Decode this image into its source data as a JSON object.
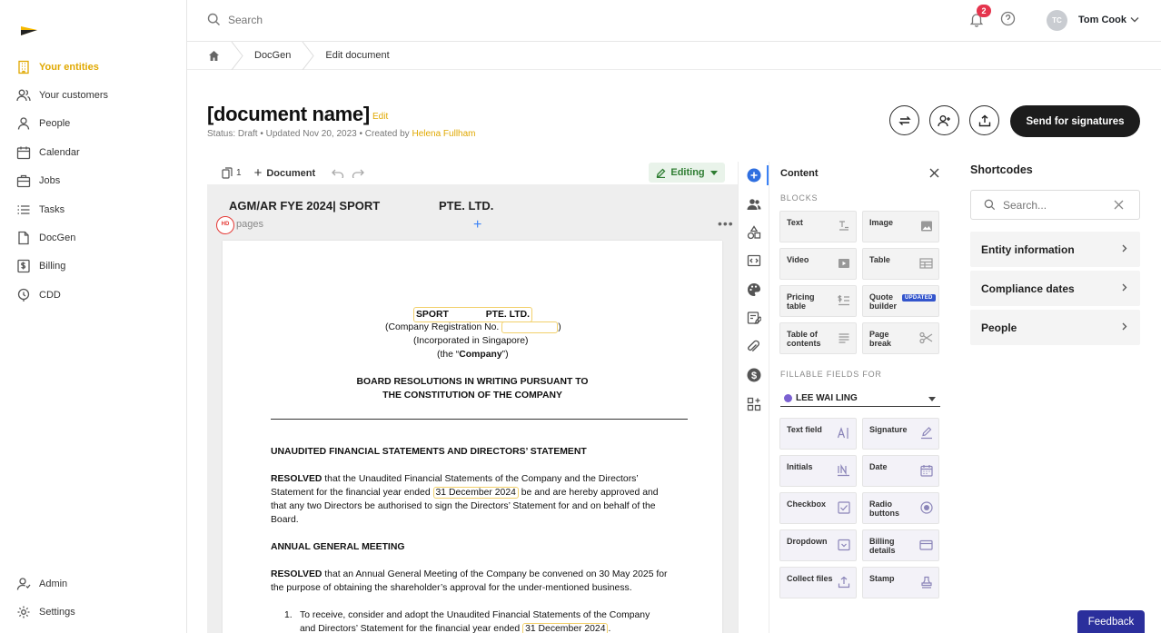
{
  "colors": {
    "accent": "#e0a800",
    "primary_dark": "#1c1c1c",
    "feedback": "#2b2f9c",
    "badge": "#e5344d"
  },
  "sidebar": {
    "items": [
      {
        "label": "Your entities",
        "icon": "building-icon"
      },
      {
        "label": "Your customers",
        "icon": "users-icon"
      },
      {
        "label": "People",
        "icon": "person-icon"
      },
      {
        "label": "Calendar",
        "icon": "calendar-icon"
      },
      {
        "label": "Jobs",
        "icon": "briefcase-icon"
      },
      {
        "label": "Tasks",
        "icon": "list-icon"
      },
      {
        "label": "DocGen",
        "icon": "document-icon"
      },
      {
        "label": "Billing",
        "icon": "billing-icon"
      },
      {
        "label": "CDD",
        "icon": "cdd-icon"
      }
    ],
    "bottom": [
      {
        "label": "Admin",
        "icon": "admin-icon"
      },
      {
        "label": "Settings",
        "icon": "gear-icon"
      }
    ]
  },
  "topbar": {
    "search_placeholder": "Search",
    "notification_count": "2",
    "user_initials": "TC",
    "user_name": "Tom Cook"
  },
  "breadcrumb": {
    "items": [
      "DocGen",
      "Edit document"
    ]
  },
  "document": {
    "title": "[document name]",
    "edit_label": "Edit",
    "status_text": "Status: Draft • Updated Nov 20, 2023 • Created by",
    "created_by": "Helena Fullham"
  },
  "actions": {
    "send_label": "Send for signatures"
  },
  "editor": {
    "page_count": "1",
    "add_document_label": "Document",
    "mode_label": "Editing",
    "header_left": "AGM/AR FYE 2024| SPORT",
    "header_right": "PTE. LTD.",
    "hd_badge": "HD",
    "pages_label": "pages"
  },
  "page": {
    "company_a": "SPORT",
    "company_b": "PTE. LTD.",
    "reg_label": "(Company Registration No.",
    "reg_close": ")",
    "incorporated": "(Incorporated in Singapore)",
    "the_company_pre": "(the “",
    "the_company_bold": "Company",
    "the_company_post": "”)",
    "heading1": "BOARD RESOLUTIONS IN WRITING PURSUANT TO",
    "heading2": "THE CONSTITUTION OF THE COMPANY",
    "section1": "UNAUDITED FINANCIAL STATEMENTS AND DIRECTORS’ STATEMENT",
    "resolved": "RESOLVED",
    "p1_a": "that the Unaudited Financial Statements of the Company and the Directors’",
    "p1_b": "Statement for the financial year ended",
    "p1_date": "31 December 2024",
    "p1_c": "be and are hereby approved and",
    "p1_d": "that any two Directors be authorised to sign the Directors’ Statement for and on behalf of the",
    "p1_e": "Board.",
    "section2": "ANNUAL GENERAL MEETING",
    "p2_a": "that an Annual General Meeting of the Company be convened on 30 May 2025 for",
    "p2_b": "the purpose of obtaining the shareholder’s approval for the under-mentioned business.",
    "li_num": "1.",
    "li_a": "To receive, consider and adopt the Unaudited Financial Statements of the Company",
    "li_b": "and Directors’ Statement for the financial year ended",
    "li_date": "31 December 2024",
    "li_end": "."
  },
  "content_panel": {
    "title": "Content",
    "blocks_heading": "BLOCKS",
    "blocks": [
      {
        "label": "Text",
        "icon": "text-format-icon"
      },
      {
        "label": "Image",
        "icon": "image-icon"
      },
      {
        "label": "Video",
        "icon": "video-icon"
      },
      {
        "label": "Table",
        "icon": "table-icon"
      },
      {
        "label": "Pricing table",
        "icon": "pricing-icon"
      },
      {
        "label": "Quote builder",
        "icon": "quote-icon",
        "badge": "UPDATED"
      },
      {
        "label": "Table of contents",
        "icon": "toc-icon"
      },
      {
        "label": "Page break",
        "icon": "scissors-icon"
      }
    ],
    "fillable_heading": "FILLABLE FIELDS FOR",
    "signer": "LEE WAI LING",
    "fields": [
      {
        "label": "Text field",
        "icon": "text-field-icon"
      },
      {
        "label": "Signature",
        "icon": "pen-icon"
      },
      {
        "label": "Initials",
        "icon": "initials-icon"
      },
      {
        "label": "Date",
        "icon": "calendar-icon"
      },
      {
        "label": "Checkbox",
        "icon": "checkbox-icon"
      },
      {
        "label": "Radio buttons",
        "icon": "radio-icon"
      },
      {
        "label": "Dropdown",
        "icon": "dropdown-icon"
      },
      {
        "label": "Billing details",
        "icon": "card-icon"
      },
      {
        "label": "Collect files",
        "icon": "upload-icon"
      },
      {
        "label": "Stamp",
        "icon": "stamp-icon"
      }
    ]
  },
  "shortcodes": {
    "title": "Shortcodes",
    "search_placeholder": "Search...",
    "items": [
      "Entity information",
      "Compliance dates",
      "People"
    ]
  },
  "feedback_label": "Feedback"
}
